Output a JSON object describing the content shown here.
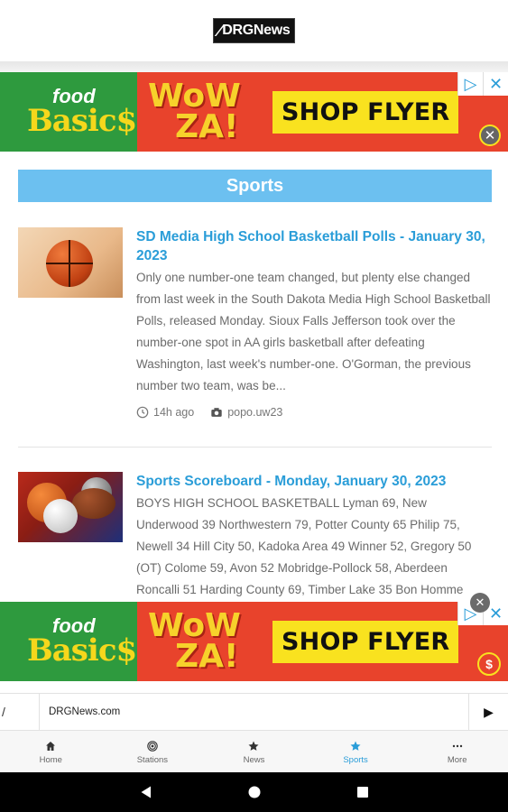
{
  "header": {
    "logo_text": "DRGNews"
  },
  "ads": {
    "food_small": "food",
    "food_big": "Basic$",
    "wow_line1": "WoW",
    "wow_line2": "ZA!",
    "flyer_label": "SHOP FLYER",
    "adchoice_icon": "▷",
    "close_symbol": "✕",
    "coin_symbol": "$",
    "dismiss_symbol": "✕"
  },
  "section": {
    "title": "Sports"
  },
  "articles": [
    {
      "title": "SD Media High School Basketball Polls - January 30, 2023",
      "excerpt": "Only one number-one team changed, but plenty else changed from last week in the South Dakota Media High School Basketball Polls, released Monday. Sioux Falls Jefferson took over the number-one spot in AA girls basketball after defeating Washington, last week's number-one. O'Gorman, the previous number two team, was be...",
      "time": "14h ago",
      "author": "popo.uw23"
    },
    {
      "title": "Sports Scoreboard - Monday, January 30, 2023",
      "excerpt": "BOYS HIGH SCHOOL BASKETBALL Lyman 69, New Underwood 39 Northwestern 79, Potter County 65 Philip 75, Newell 34 Hill City 50, Kadoka Area 49 Winner 52, Gregory 50 (OT) Colome 59, Avon 52 Mobridge-Pollock 58, Aberdeen Roncalli 51 Harding County 69, Timber Lake 35 Bon Homme"
    }
  ],
  "player": {
    "title": "DRGNews.com",
    "left_symbol": "/",
    "play_symbol": "▶"
  },
  "nav": {
    "items": [
      {
        "label": "Home",
        "icon": "home-icon"
      },
      {
        "label": "Stations",
        "icon": "radio-icon"
      },
      {
        "label": "News",
        "icon": "star-icon"
      },
      {
        "label": "Sports",
        "icon": "star-icon"
      },
      {
        "label": "More",
        "icon": "more-icon"
      }
    ],
    "active": "Sports"
  },
  "colors": {
    "accent": "#2a9dd8",
    "banner": "#6cc0f0",
    "ad_green": "#2e9a3e",
    "ad_red": "#e8432c",
    "ad_yellow": "#f9e21f"
  }
}
